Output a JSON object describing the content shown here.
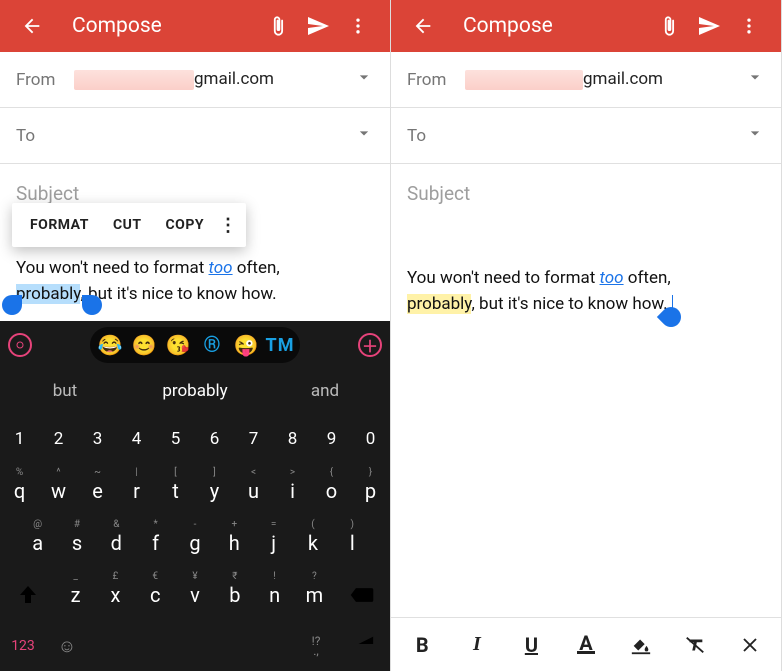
{
  "appbar": {
    "title": "Compose"
  },
  "from": {
    "label": "From",
    "domain": "gmail.com"
  },
  "to": {
    "label": "To"
  },
  "subject": {
    "placeholder": "Subject"
  },
  "contextMenu": {
    "format": "FORMAT",
    "cut": "CUT",
    "copy": "COPY"
  },
  "body": {
    "line1a": "You won't need to format ",
    "too": "too",
    "line1b": " often, ",
    "highlighted": "probably",
    "line2": ", but it's nice to know how. "
  },
  "keyboard": {
    "suggestions": {
      "left": "but",
      "center": "probably",
      "right": "and"
    },
    "numRow": [
      "1",
      "2",
      "3",
      "4",
      "5",
      "6",
      "7",
      "8",
      "9",
      "0"
    ],
    "row1": [
      "q",
      "w",
      "e",
      "r",
      "t",
      "y",
      "u",
      "i",
      "o",
      "p"
    ],
    "row1sup": [
      "%",
      "^",
      "~",
      "|",
      "[",
      "]",
      "<",
      ">",
      "{",
      "}"
    ],
    "row2": [
      "a",
      "s",
      "d",
      "f",
      "g",
      "h",
      "j",
      "k",
      "l"
    ],
    "row2sup": [
      "@",
      "#",
      "&",
      "*",
      "-",
      "+",
      "=",
      "(",
      ")"
    ],
    "row3": [
      "z",
      "x",
      "c",
      "v",
      "b",
      "n",
      "m"
    ],
    "row3sup": [
      "_",
      "£",
      "€",
      "¥",
      "₹",
      "!",
      "?"
    ],
    "k123": "123",
    "punc": "!?\n.,",
    "emoji": {
      "r": "®",
      "tm": "TM"
    }
  },
  "formatBar": {
    "bold": "B",
    "italic": "I",
    "underline": "U",
    "textcolor": "A"
  }
}
